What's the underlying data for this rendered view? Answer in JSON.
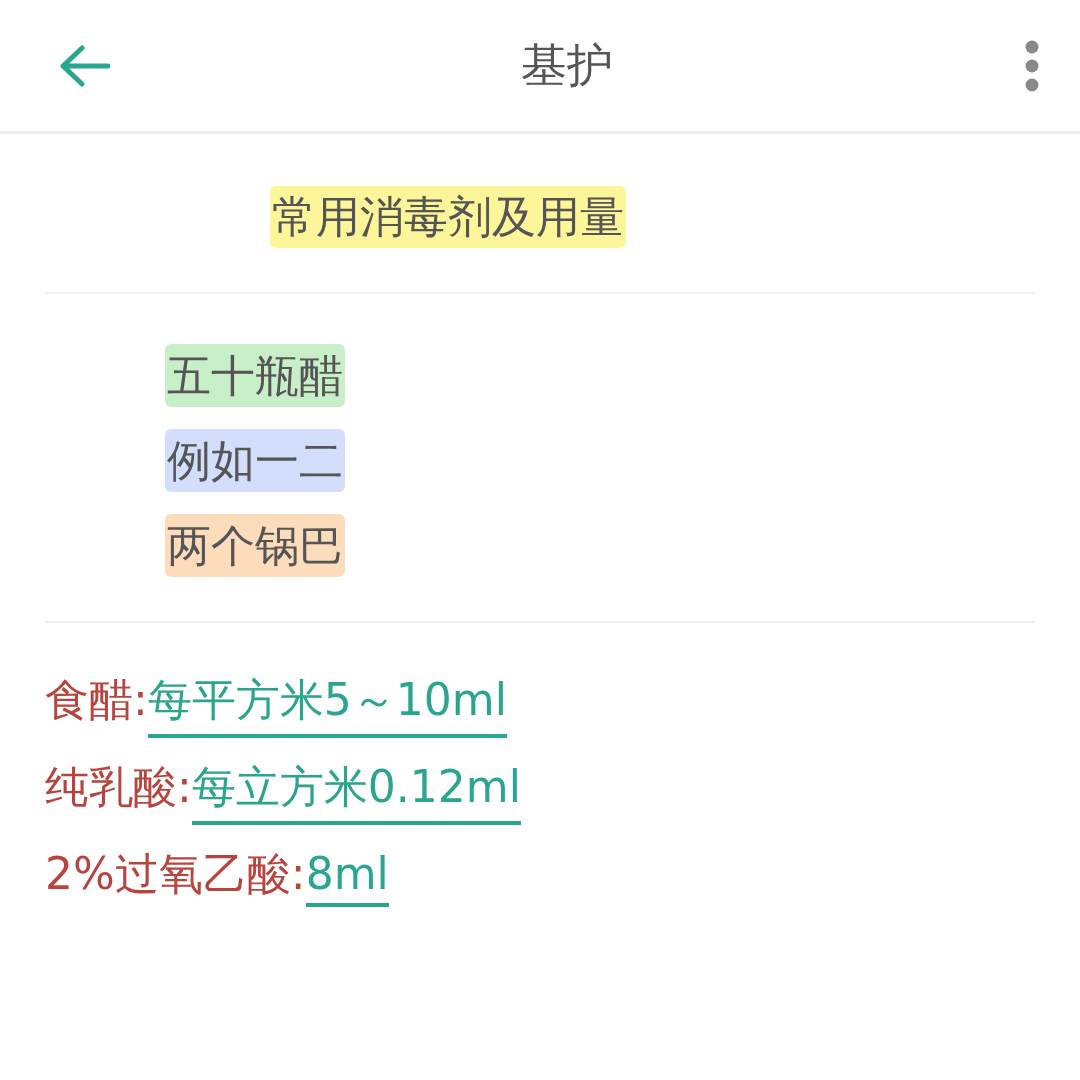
{
  "header": {
    "title": "基护"
  },
  "heading": "常用消毒剂及用量",
  "tags": [
    {
      "text": "五十瓶醋",
      "color": "#c9efc9"
    },
    {
      "text": "例如一二",
      "color": "#d3defd"
    },
    {
      "text": "两个锅巴",
      "color": "#fddcbc"
    }
  ],
  "dosages": [
    {
      "name": "食醋:",
      "value": "每平方米5～10ml"
    },
    {
      "name": "纯乳酸:",
      "value": "每立方米0.12ml"
    },
    {
      "name": "2%过氧乙酸:",
      "value": "8ml"
    }
  ]
}
